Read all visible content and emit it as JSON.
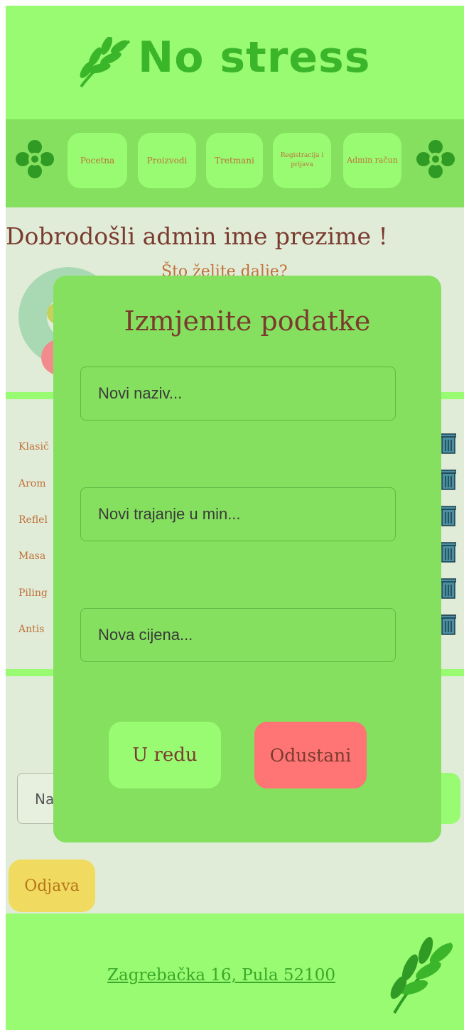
{
  "header": {
    "title": "No stress",
    "logo_icon": "leaf-branch-icon"
  },
  "nav": {
    "items": [
      {
        "label": "Pocetna"
      },
      {
        "label": "Proizvodi"
      },
      {
        "label": "Tretmani"
      },
      {
        "label": "Registracija i prijava"
      },
      {
        "label": "Admin račun"
      }
    ],
    "ornament_icon": "green-flower-ornament-icon"
  },
  "main": {
    "welcome": "Dobrodošli admin ime prezime !",
    "subtitle": "Što želite dalje?",
    "treatments": [
      "Klasič",
      "Arom",
      "Reflel",
      "Masa",
      "Piling",
      "Antis"
    ],
    "new_input_placeholder": "Na",
    "logout_label": "Odjava"
  },
  "modal": {
    "title": "Izmjenite podatke",
    "name_placeholder": "Novi naziv...",
    "duration_placeholder": "Novi trajanje u min...",
    "price_placeholder": "Nova cijena...",
    "ok_label": "U redu",
    "cancel_label": "Odustani"
  },
  "footer": {
    "address": "Zagrebačka 16, Pula 52100"
  },
  "colors": {
    "header_bg": "#98fb72",
    "nav_bg": "#84e05e",
    "page_bg": "#e0ecd8",
    "title_green": "#3bb62a",
    "text_brown": "#7a3b2e",
    "accent_orange": "#c0713a",
    "cancel_red": "#ff7474",
    "logout_yellow": "#f0db60"
  }
}
